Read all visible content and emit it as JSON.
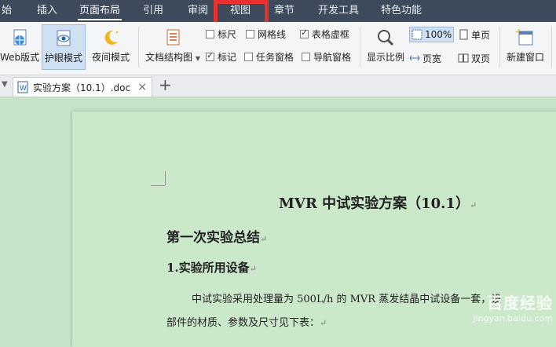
{
  "menu": {
    "tabs": [
      "始",
      "插入",
      "页面布局",
      "引用",
      "审阅",
      "视图",
      "章节",
      "开发工具",
      "特色功能"
    ],
    "active_tab": "页面布局",
    "highlighted_tab": "视图"
  },
  "ribbon": {
    "web_layout": "Web版式",
    "eye_protect": "护眼模式",
    "night_mode": "夜间模式",
    "doc_structure": "文档结构图",
    "ruler": "标尺",
    "gridlines": "网格线",
    "table_gridlines": "表格虚框",
    "marks": "标记",
    "task_pane": "任务窗格",
    "nav_pane": "导航窗格",
    "zoom": "显示比例",
    "zoom_100": "100%",
    "page_width": "页宽",
    "single_page": "单页",
    "double_page": "双页",
    "new_window": "新建窗口"
  },
  "tabbar": {
    "doc_tab": "实验方案（10.1）.doc",
    "close": "×",
    "add": "+"
  },
  "document": {
    "title": "MVR 中试实验方案（10.1）",
    "heading1": "第一次实验总结",
    "heading2": "1.实验所用设备",
    "para1": "中试实验采用处理量为 500L/h 的 MVR 蒸发结晶中试设备一套，设",
    "para2": "部件的材质、参数及尺寸见下表：",
    "para_mark": "↵"
  },
  "watermark": {
    "line1": "百度经验",
    "line2": "jingyan.baidu.com"
  },
  "colors": {
    "menubar": "#3d4a5c",
    "highlight": "#e8302f",
    "doc_bg": "#c7e3c7"
  }
}
